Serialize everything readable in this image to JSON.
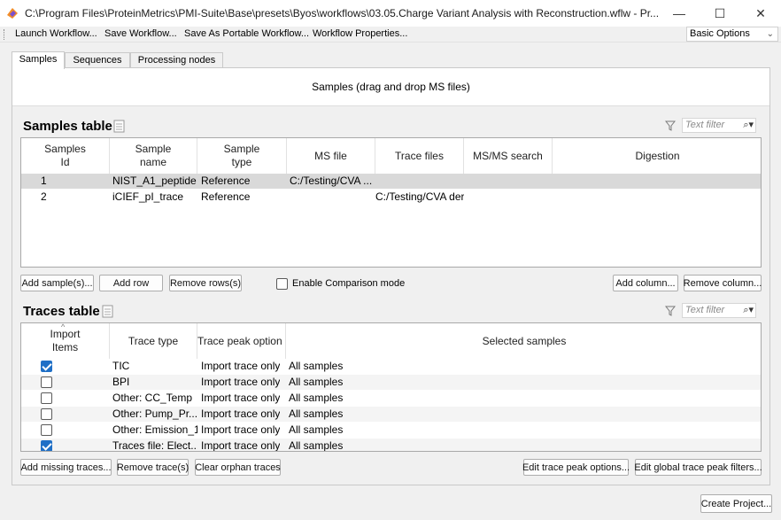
{
  "window": {
    "title": "C:\\Program Files\\ProteinMetrics\\PMI-Suite\\Base\\presets\\Byos\\workflows\\03.05.Charge Variant Analysis with Reconstruction.wflw - Pr...",
    "minimize_glyph": "—",
    "maximize_glyph": "☐",
    "close_glyph": "✕"
  },
  "menu": {
    "items": [
      "Launch Workflow...",
      "Save Workflow...",
      "Save As Portable Workflow...",
      "Workflow Properties..."
    ],
    "options_dropdown": "Basic Options"
  },
  "tabs": [
    {
      "label": "Samples",
      "active": true
    },
    {
      "label": "Sequences",
      "active": false
    },
    {
      "label": "Processing nodes",
      "active": false
    }
  ],
  "dropzone_text": "Samples (drag and drop MS files)",
  "samples_table": {
    "title": "Samples table",
    "filter_placeholder": "Text filter",
    "columns": [
      "Samples\nId",
      "Sample\nname",
      "Sample\ntype",
      "MS file",
      "Trace files",
      "MS/MS search",
      "Digestion"
    ],
    "rows": [
      {
        "id": "1",
        "name": "NIST_A1_peptide",
        "type": "Reference",
        "ms_file": "C:/Testing/CVA ...",
        "trace_files": "",
        "msms": "",
        "digestion": "",
        "selected": true
      },
      {
        "id": "2",
        "name": "iCIEF_pI_trace",
        "type": "Reference",
        "ms_file": "",
        "trace_files": "C:/Testing/CVA der",
        "msms": "",
        "digestion": "",
        "selected": false
      }
    ],
    "buttons": {
      "add_samples": "Add sample(s)...",
      "add_row": "Add row",
      "remove_rows": "Remove rows(s)",
      "add_column": "Add column...",
      "remove_column": "Remove column..."
    },
    "comparison_mode": {
      "label": "Enable Comparison mode",
      "checked": false
    }
  },
  "traces_table": {
    "title": "Traces table",
    "filter_placeholder": "Text filter",
    "columns": [
      "Import\nItems",
      "Trace type",
      "Trace peak option",
      "Selected samples"
    ],
    "rows": [
      {
        "import": true,
        "trace_type": "TIC",
        "peak_option": "Import trace only",
        "samples": "All samples"
      },
      {
        "import": false,
        "trace_type": "BPI",
        "peak_option": "Import trace only",
        "samples": "All samples"
      },
      {
        "import": false,
        "trace_type": "Other: CC_Temp",
        "peak_option": "Import trace only",
        "samples": "All samples"
      },
      {
        "import": false,
        "trace_type": "Other: Pump_Pr...",
        "peak_option": "Import trace only",
        "samples": "All samples"
      },
      {
        "import": false,
        "trace_type": "Other: Emission_1",
        "peak_option": "Import trace only",
        "samples": "All samples"
      },
      {
        "import": true,
        "trace_type": "Traces file: Elect...",
        "peak_option": "Import trace only",
        "samples": "All samples"
      }
    ],
    "buttons": {
      "add_missing": "Add missing traces...",
      "remove_traces": "Remove trace(s)",
      "clear_orphan": "Clear orphan traces",
      "edit_peak_options": "Edit trace peak options...",
      "edit_global_filters": "Edit global trace peak filters..."
    }
  },
  "footer": {
    "create_project": "Create Project..."
  },
  "colors": {
    "accent": "#1f6fc6",
    "selected_row": "#d9d9d9",
    "background": "#f0f0f0"
  }
}
